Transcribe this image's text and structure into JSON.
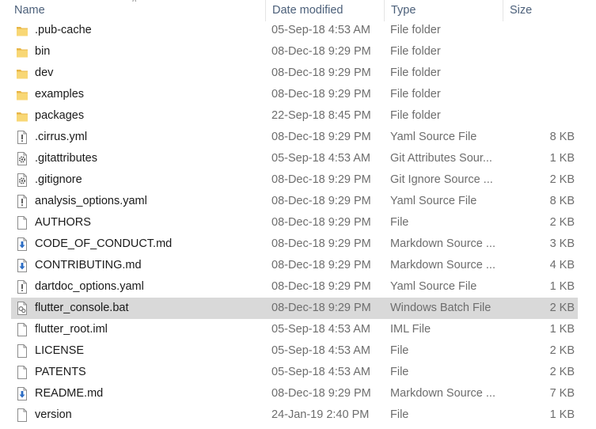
{
  "header": {
    "name": "Name",
    "date_modified": "Date modified",
    "type": "Type",
    "size": "Size"
  },
  "files": [
    {
      "name": ".pub-cache",
      "date": "05-Sep-18 4:53 AM",
      "type": "File folder",
      "size": "",
      "icon": "folder-icon"
    },
    {
      "name": "bin",
      "date": "08-Dec-18 9:29 PM",
      "type": "File folder",
      "size": "",
      "icon": "folder-icon"
    },
    {
      "name": "dev",
      "date": "08-Dec-18 9:29 PM",
      "type": "File folder",
      "size": "",
      "icon": "folder-icon"
    },
    {
      "name": "examples",
      "date": "08-Dec-18 9:29 PM",
      "type": "File folder",
      "size": "",
      "icon": "folder-icon"
    },
    {
      "name": "packages",
      "date": "22-Sep-18 8:45 PM",
      "type": "File folder",
      "size": "",
      "icon": "folder-icon"
    },
    {
      "name": ".cirrus.yml",
      "date": "08-Dec-18 9:29 PM",
      "type": "Yaml Source File",
      "size": "8 KB",
      "icon": "yaml-file-icon"
    },
    {
      "name": ".gitattributes",
      "date": "05-Sep-18 4:53 AM",
      "type": "Git Attributes Sour...",
      "size": "1 KB",
      "icon": "config-file-icon"
    },
    {
      "name": ".gitignore",
      "date": "08-Dec-18 9:29 PM",
      "type": "Git Ignore Source ...",
      "size": "2 KB",
      "icon": "config-file-icon"
    },
    {
      "name": "analysis_options.yaml",
      "date": "08-Dec-18 9:29 PM",
      "type": "Yaml Source File",
      "size": "8 KB",
      "icon": "yaml-file-icon"
    },
    {
      "name": "AUTHORS",
      "date": "08-Dec-18 9:29 PM",
      "type": "File",
      "size": "2 KB",
      "icon": "blank-file-icon"
    },
    {
      "name": "CODE_OF_CONDUCT.md",
      "date": "08-Dec-18 9:29 PM",
      "type": "Markdown Source ...",
      "size": "3 KB",
      "icon": "markdown-file-icon"
    },
    {
      "name": "CONTRIBUTING.md",
      "date": "08-Dec-18 9:29 PM",
      "type": "Markdown Source ...",
      "size": "4 KB",
      "icon": "markdown-file-icon"
    },
    {
      "name": "dartdoc_options.yaml",
      "date": "08-Dec-18 9:29 PM",
      "type": "Yaml Source File",
      "size": "1 KB",
      "icon": "yaml-file-icon"
    },
    {
      "name": "flutter_console.bat",
      "date": "08-Dec-18 9:29 PM",
      "type": "Windows Batch File",
      "size": "2 KB",
      "icon": "batch-file-icon",
      "selected": true
    },
    {
      "name": "flutter_root.iml",
      "date": "05-Sep-18 4:53 AM",
      "type": "IML File",
      "size": "1 KB",
      "icon": "blank-file-icon"
    },
    {
      "name": "LICENSE",
      "date": "05-Sep-18 4:53 AM",
      "type": "File",
      "size": "2 KB",
      "icon": "blank-file-icon"
    },
    {
      "name": "PATENTS",
      "date": "05-Sep-18 4:53 AM",
      "type": "File",
      "size": "2 KB",
      "icon": "blank-file-icon"
    },
    {
      "name": "README.md",
      "date": "08-Dec-18 9:29 PM",
      "type": "Markdown Source ...",
      "size": "7 KB",
      "icon": "markdown-file-icon"
    },
    {
      "name": "version",
      "date": "24-Jan-19 2:40 PM",
      "type": "File",
      "size": "1 KB",
      "icon": "blank-file-icon"
    }
  ],
  "colors": {
    "header_text": "#4c607a",
    "selected_row": "#d9d9d9",
    "folder_yellow": "#f8d775",
    "folder_dark": "#e8b646"
  }
}
